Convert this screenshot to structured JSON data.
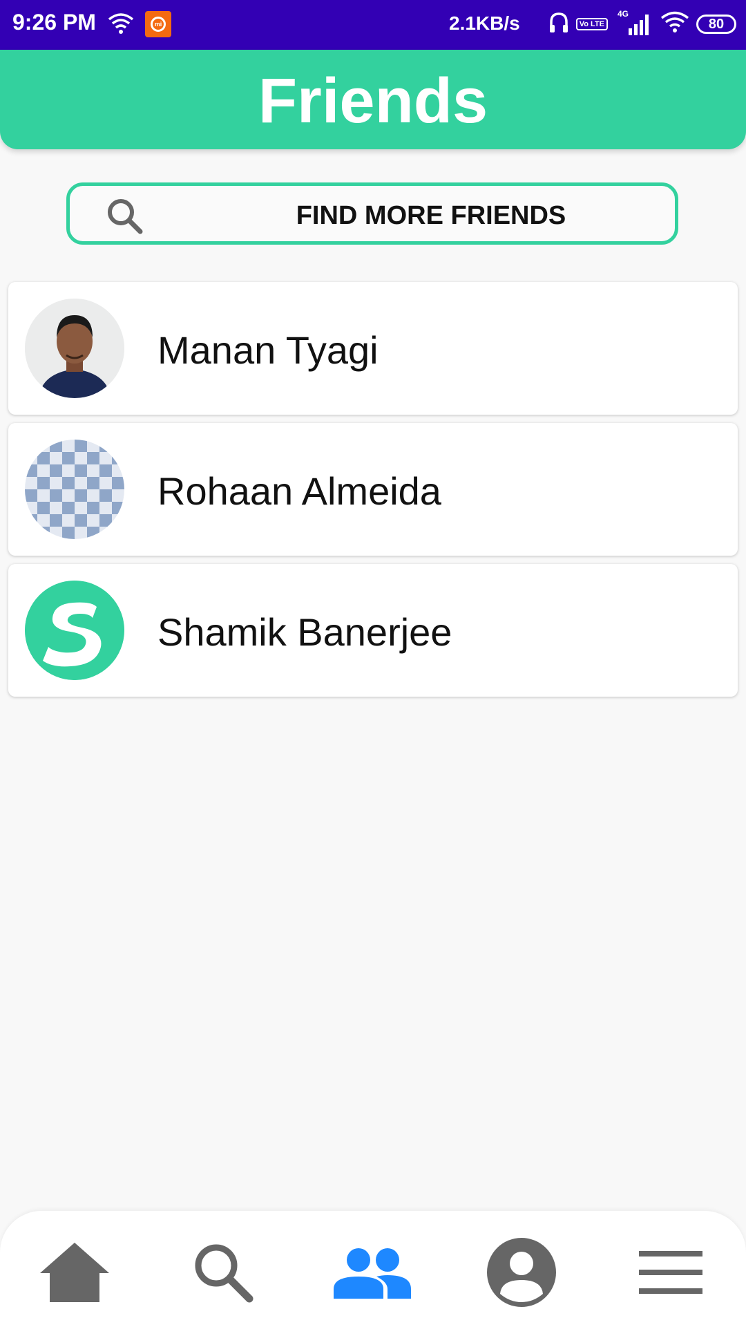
{
  "status_bar": {
    "time": "9:26 PM",
    "net_speed": "2.1KB/s",
    "network_type": "4G",
    "volte": "Vo LTE",
    "battery": "80"
  },
  "header": {
    "title": "Friends"
  },
  "find_button": {
    "label": "FIND MORE FRIENDS",
    "icon": "search-icon"
  },
  "friends": [
    {
      "name": "Manan Tyagi",
      "avatar": "photo"
    },
    {
      "name": "Rohaan Almeida",
      "avatar": "checkered-pattern"
    },
    {
      "name": "Shamik Banerjee",
      "avatar": "s-logo"
    }
  ],
  "nav": {
    "items": [
      {
        "icon": "home-icon",
        "active": false
      },
      {
        "icon": "search-icon",
        "active": false
      },
      {
        "icon": "friends-icon",
        "active": true
      },
      {
        "icon": "account-icon",
        "active": false
      },
      {
        "icon": "menu-icon",
        "active": false
      }
    ],
    "active_color": "#1e88ff",
    "inactive_color": "#666666"
  },
  "colors": {
    "status_bar": "#3300b4",
    "accent": "#33d19e"
  }
}
